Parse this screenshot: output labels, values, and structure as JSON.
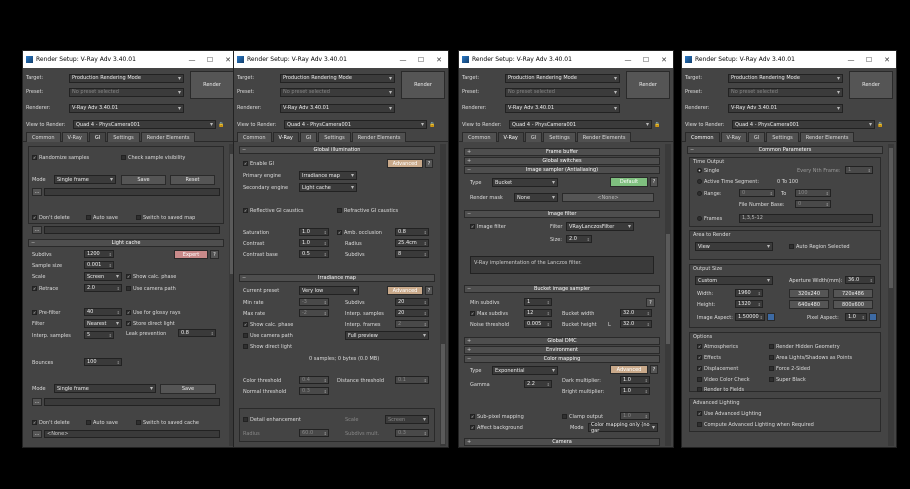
{
  "window_title": "Render Setup: V-Ray Adv 3.40.01",
  "controls": {
    "minimize": "—",
    "maximize": "☐",
    "close": "✕"
  },
  "labels": {
    "target": "Target:",
    "preset": "Preset:",
    "renderer": "Renderer:",
    "view_to_render": "View to Render:",
    "render": "Render"
  },
  "values": {
    "target": "Production Rendering Mode",
    "preset": "No preset selected",
    "renderer": "V-Ray Adv 3.40.01",
    "view": "Quad 4 - PhysCamera001"
  },
  "tabs": [
    "Common",
    "V-Ray",
    "GI",
    "Settings",
    "Render Elements"
  ],
  "gi": {
    "randomize": "Randomize samples",
    "check_vis": "Check sample visibility",
    "mode_label": "Mode",
    "mode_value": "Single frame",
    "save": "Save",
    "reset": "Reset",
    "dont_delete": "Don't delete",
    "auto_save": "Auto save",
    "switch_saved": "Switch to saved map",
    "lc_title": "Light cache",
    "subdivs_label": "Subdivs",
    "subdivs": "1200",
    "expert": "Expert",
    "sample_size_label": "Sample size",
    "sample_size": "0.001",
    "scale_label": "Scale",
    "scale": "Screen",
    "show_calc": "Show calc. phase",
    "retrace_label": "Retrace",
    "retrace": "2.0",
    "use_cam": "Use camera path",
    "prefilter_label": "Pre-filter",
    "prefilter": "40",
    "glossy_rays": "Use for glossy rays",
    "filter_label": "Filter",
    "filter": "Nearest",
    "store_direct": "Store direct light",
    "interp_label": "Interp. samples",
    "interp": "5",
    "leak_label": "Leak prevention",
    "leak": "0.8",
    "bounces_label": "Bounces",
    "bounces": "100",
    "mode2_label": "Mode",
    "mode2": "Single frame",
    "save2": "Save",
    "dont_delete2": "Don't delete",
    "auto_save2": "Auto save",
    "switch_saved2": "Switch to saved cache",
    "none": "<None>"
  },
  "vray": {
    "gi_title": "Global illumination",
    "enable_gi": "Enable GI",
    "advanced": "Advanced",
    "help": "?",
    "primary_label": "Primary engine",
    "primary": "Irradiance map",
    "secondary_label": "Secondary engine",
    "secondary": "Light cache",
    "refl_caustics": "Reflective GI caustics",
    "refr_caustics": "Refractive GI caustics",
    "saturation_label": "Saturation",
    "saturation": "1.0",
    "amb_occ": "Amb. occlusion",
    "amb_val": "0.8",
    "contrast_label": "Contrast",
    "contrast": "1.0",
    "radius_label": "Radius",
    "radius": "25.4cm",
    "contrast_base_label": "Contrast base",
    "contrast_base": "0.5",
    "subdivs_label": "Subdivs",
    "subdivs": "8",
    "im_title": "Irradiance map",
    "preset_label": "Current preset",
    "preset": "Very low",
    "advanced2": "Advanced",
    "min_rate_label": "Min rate",
    "min_rate": "-3",
    "subdivs2_label": "Subdivs",
    "subdivs2": "20",
    "max_rate_label": "Max rate",
    "max_rate": "-2",
    "interp_label": "Interp. samples",
    "interp": "20",
    "show_calc": "Show calc. phase",
    "interp_frames_label": "Interp. frames",
    "interp_frames": "2",
    "use_cam": "Use camera path",
    "full_preview": "Full preview",
    "show_direct": "Show direct light",
    "samples_info": "0 samples; 0 bytes (0.0 MB)",
    "color_thresh_label": "Color threshold",
    "color_thresh": "0.4",
    "dist_thresh_label": "Distance threshold",
    "dist_thresh": "0.1",
    "normal_thresh_label": "Normal threshold",
    "normal_thresh": "0.3",
    "detail": "Detail enhancement",
    "scale_label": "Scale",
    "scale": "Screen",
    "radius2_label": "Radius",
    "radius2": "60.0",
    "sub_mult_label": "Subdivs mult.",
    "sub_mult": "0.3"
  },
  "settings": {
    "frame_buffer": "Frame buffer",
    "global_switches": "Global switches",
    "image_sampler": "Image sampler (Antialiasing)",
    "type_label": "Type",
    "type": "Bucket",
    "default": "Default",
    "mask_label": "Render mask",
    "mask": "None",
    "none": "<None>",
    "image_filter_title": "Image filter",
    "image_filter": "Image filter",
    "filter_label": "Filter",
    "filter": "VRayLanczosFilter",
    "size_label": "Size:",
    "size": "2.0",
    "filter_desc": "V-Ray implementation of the Lanczos filter.",
    "bucket_title": "Bucket image sampler",
    "min_subdivs_label": "Min subdivs",
    "min_subdivs": "1",
    "max_subdivs": "Max subdivs",
    "max_subdivs_val": "12",
    "bucket_width_label": "Bucket width",
    "bucket_width": "32.0",
    "noise_label": "Noise threshold",
    "noise": "0.005",
    "bucket_height_label": "Bucket height",
    "bucket_l": "L",
    "bucket_height": "32.0",
    "global_dmc": "Global DMC",
    "environment": "Environment",
    "color_mapping": "Color mapping",
    "cm_type_label": "Type",
    "cm_type": "Exponential",
    "advanced": "Advanced",
    "dark_label": "Dark multiplier:",
    "dark": "1.0",
    "gamma_label": "Gamma",
    "gamma": "2.2",
    "bright_label": "Bright multiplier:",
    "bright": "1.0",
    "subpixel": "Sub-pixel mapping",
    "clamp": "Clamp output",
    "clamp_val": "1.0",
    "affect_bg": "Affect background",
    "mode_label": "Mode",
    "mode": "Color mapping only (no gar",
    "camera": "Camera"
  },
  "common": {
    "common_params": "Common Parameters",
    "time_output": "Time Output",
    "single": "Single",
    "every_nth": "Every Nth Frame:",
    "every_nth_val": "1",
    "active_seg": "Active Time Segment:",
    "active_range": "0 To 100",
    "range": "Range:",
    "range_from": "0",
    "range_to_label": "To",
    "range_to": "100",
    "file_number_base": "File Number Base:",
    "fnb_val": "0",
    "frames": "Frames",
    "frames_val": "1,3,5-12",
    "area_to_render": "Area to Render",
    "area": "View",
    "auto_region": "Auto Region Selected",
    "output_size": "Output Size",
    "output": "Custom",
    "aperture_label": "Aperture Width(mm):",
    "aperture": "36.0",
    "width_label": "Width:",
    "width": "1960",
    "height_label": "Height:",
    "height": "1320",
    "p1": "320x240",
    "p2": "720x486",
    "p3": "640x480",
    "p4": "800x600",
    "image_aspect_label": "Image Aspect:",
    "image_aspect": "1.50000",
    "pixel_aspect_label": "Pixel Aspect:",
    "pixel_aspect": "1.0",
    "options": "Options",
    "atmospherics": "Atmospherics",
    "render_hidden": "Render Hidden Geometry",
    "effects": "Effects",
    "area_lights": "Area Lights/Shadows as Points",
    "displacement": "Displacement",
    "force2": "Force 2-Sided",
    "video_check": "Video Color Check",
    "super_black": "Super Black",
    "render_fields": "Render to Fields",
    "adv_lighting": "Advanced Lighting",
    "use_adv": "Use Advanced Lighting",
    "compute_adv": "Compute Advanced Lighting when Required"
  },
  "colors": {
    "expert": "#c98a8a",
    "advanced": "#c9a98a",
    "default": "#7fbf7f"
  }
}
